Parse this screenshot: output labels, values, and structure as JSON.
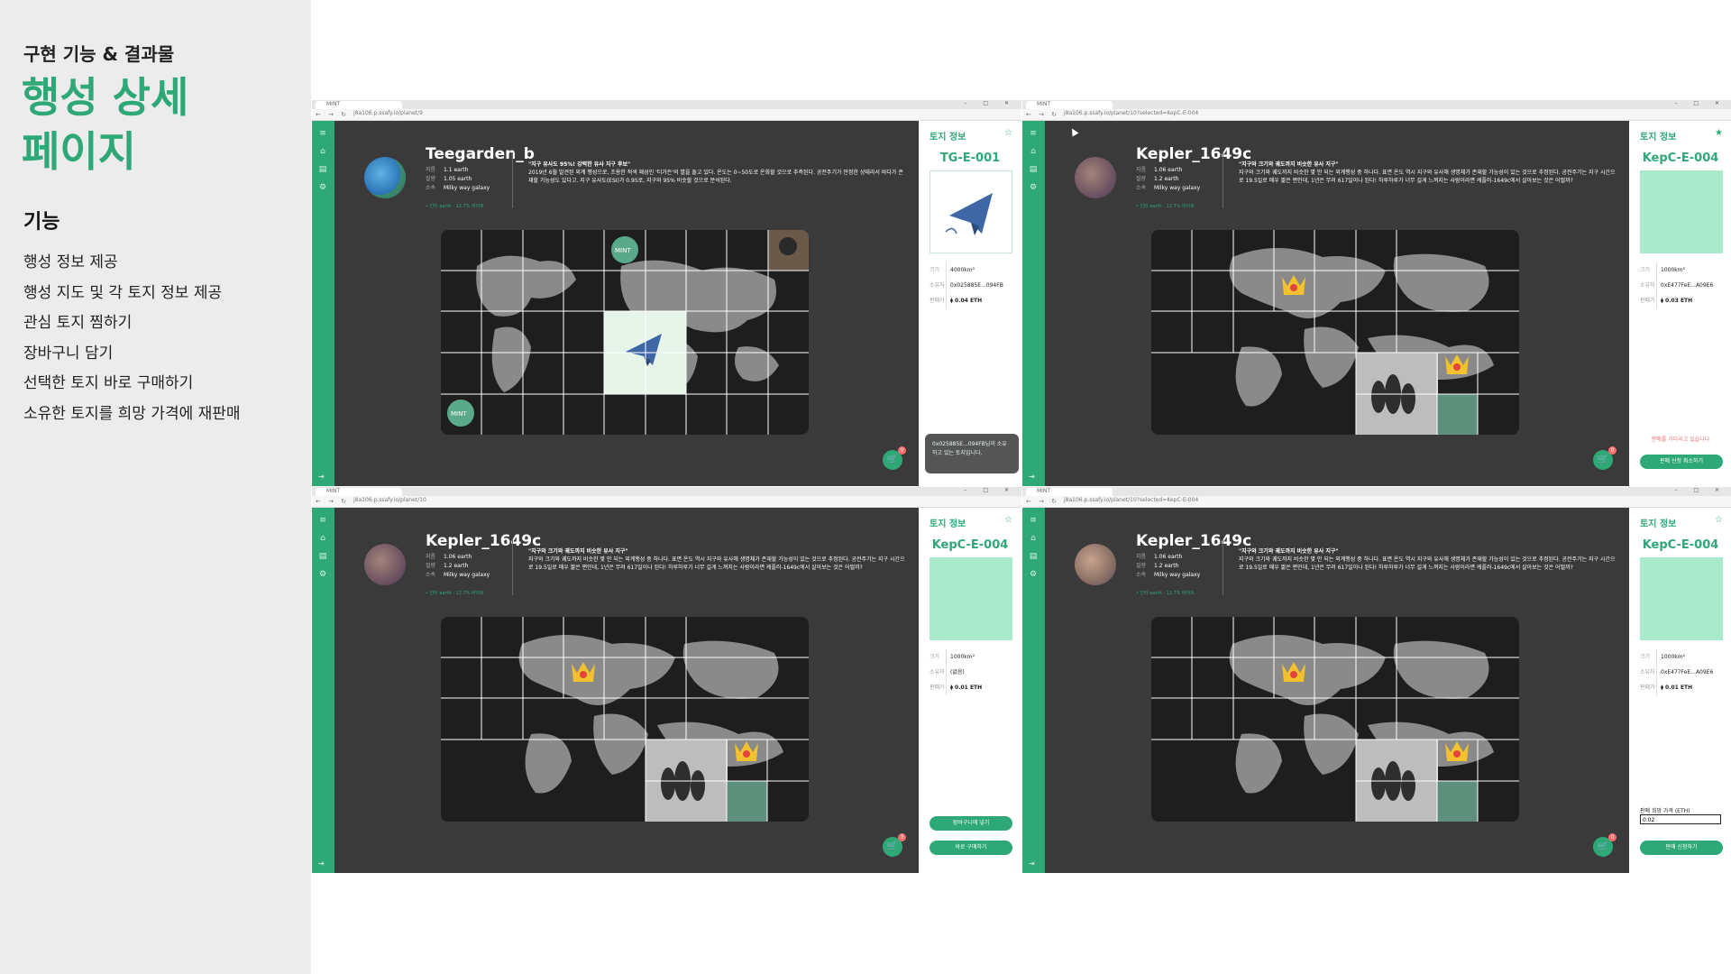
{
  "slide": {
    "eyebrow": "구현 기능 & 결과물",
    "title_line1": "행성 상세",
    "title_line2": "페이지",
    "features_heading": "기능",
    "features": [
      "행성 정보 제공",
      "행성 지도 및 각 토지 정보 제공",
      "관심 토지 찜하기",
      "장바구니 담기",
      "선택한 토지 바로 구매하기",
      "소유한 토지를 희망 가격에 재판매"
    ]
  },
  "common": {
    "tab_label": "MINT",
    "win_buttons": "– □ ✕",
    "nav_icons": "← → ↻",
    "panel_title": "토지 정보",
    "star": "☆",
    "star_filled": "★",
    "cart_icon": "🛒",
    "size_key": "크기",
    "owner_key": "소유자",
    "price_key": "판매가",
    "name_key": "지름",
    "mass_key": "질량",
    "galaxy_key": "소속",
    "logout_icon": "⇥"
  },
  "panels": [
    {
      "url": "j8a106.p.ssafy.io/planet/9",
      "planet_name": "Teegarden_b",
      "diameter": "1.1 earth",
      "mass": "1.05 earth",
      "galaxy": "Milky way galaxy",
      "green_note": "• 인터 earth : 12.7% 바이트",
      "desc_title": "\"지구 유사도 95%! 강력한 유사 지구 후보\"",
      "desc_body": "2019년 6월 발견된 외계 행성으로, 조용한 적색 왜성인 '티가든'의 별을 돌고 있다. 온도는 0~50도로 온화할 것으로 추측된다. 공전주기가 안정한 상태라서 바다가 존재할 가능성도 있다고. 지구 유사도(ESI)가 0.95로, 지구와 95% 비슷할 것으로 분석된다.",
      "land_id": "TG-E-001",
      "size": "4000km²",
      "owner": "0x025885E...094FB",
      "price": "⧫ 0.04 ETH",
      "toast": "0x025885E...094FB님이 소유하고 있는 토지입니다.",
      "cart_count": "0"
    },
    {
      "url": "j8a106.p.ssafy.io/planet/10?selected=KepC-E-004",
      "planet_name": "Kepler_1649c",
      "diameter": "1.06 earth",
      "mass": "1.2 earth",
      "galaxy": "Milky way galaxy",
      "green_note": "• 인터 earth : 12.7% 바이트",
      "desc_title": "\"지구와 크기와 궤도까지 비슷한 유사 지구\"",
      "desc_body": "지구와 크기와 궤도까지 비슷한 몇 안 되는 외계행성 중 하나다. 표면 온도 역시 지구와 유사해 생명체가 존재할 가능성이 있는 것으로 추정된다. 공전주기는 지구 시간으로 19.5일로 매우 짧은 편인데, 1년은 무려 617일이나 된다! 하루하루가 너무 길게 느껴지는 사람이라면 케플러-1649c에서 살아보는 것은 어떨까?",
      "land_id": "KepC-E-004",
      "size": "1000km²",
      "owner": "0xE477FeE...A09E6",
      "price": "⧫ 0.03 ETH",
      "red_note": "판매를 기다리고 있습니다",
      "button1": "판매 신청 취소하기",
      "cart_count": "0"
    },
    {
      "url": "j8a106.p.ssafy.io/planet/10",
      "planet_name": "Kepler_1649c",
      "diameter": "1.06 earth",
      "mass": "1.2 earth",
      "galaxy": "Milky way galaxy",
      "green_note": "• 인터 earth : 12.7% 바이트",
      "desc_title": "\"지구와 크기와 궤도까지 비슷한 유사 지구\"",
      "desc_body": "지구와 크기와 궤도까지 비슷한 몇 안 되는 외계행성 중 하나다. 표면 온도 역시 지구와 유사해 생명체가 존재할 가능성이 있는 것으로 추정된다. 공전주기는 지구 시간으로 19.5일로 매우 짧은 편인데, 1년은 무려 617일이나 된다! 하루하루가 너무 길게 느껴지는 사람이라면 케플러-1649c에서 살아보는 것은 어떨까?",
      "land_id": "KepC-E-004",
      "size": "1000km²",
      "owner": "(없음)",
      "price": "⧫ 0.01 ETH",
      "button1": "장바구니에 넣기",
      "button2": "바로 구매하기",
      "cart_count": "3"
    },
    {
      "url": "j8a106.p.ssafy.io/planet/10?selected=KepC-E-004",
      "planet_name": "Kepler_1649c",
      "diameter": "1.06 earth",
      "mass": "1.2 earth",
      "galaxy": "Milky way galaxy",
      "green_note": "• 인터 earth : 12.7% 바이트",
      "desc_title": "\"지구와 크기와 궤도까지 비슷한 유사 지구\"",
      "desc_body": "지구와 크기와 궤도까지 비슷한 몇 안 되는 외계행성 중 하나다. 표면 온도 역시 지구와 유사해 생명체가 존재할 가능성이 있는 것으로 추정된다. 공전주기는 지구 시간으로 19.5일로 매우 짧은 편인데, 1년은 무려 617일이나 된다! 하루하루가 너무 길게 느껴지는 사람이라면 케플러-1649c에서 살아보는 것은 어떨까?",
      "land_id": "KepC-E-004",
      "size": "1000km²",
      "owner": "0xE477FeE...A09E6",
      "price": "⧫ 0.01 ETH",
      "input_label": "판매 희망 가격 (ETH)",
      "input_value": "0.02",
      "button1": "판매 신청하기",
      "cart_count": "0"
    }
  ]
}
